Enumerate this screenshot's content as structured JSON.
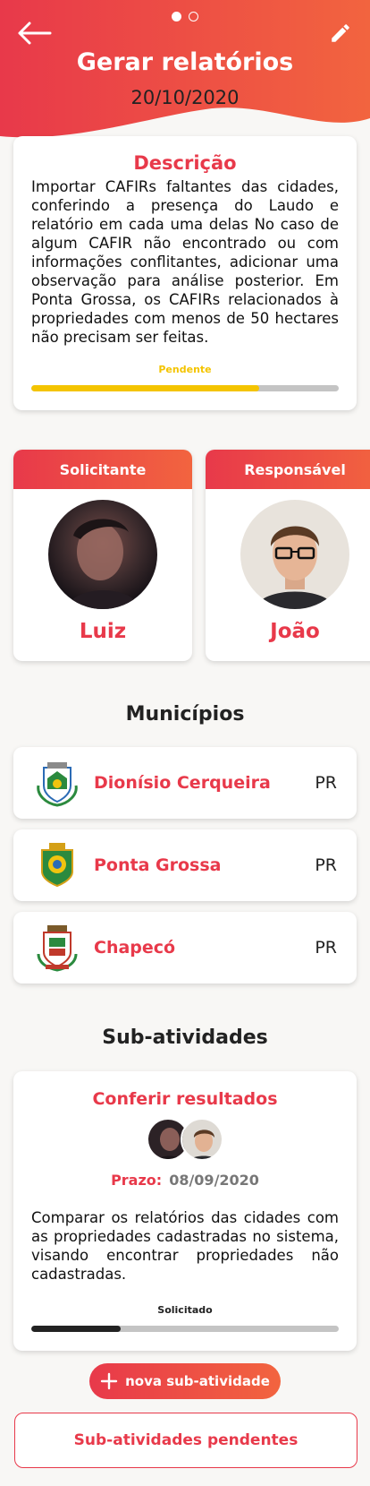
{
  "header": {
    "title": "Gerar relatórios",
    "date": "20/10/2020",
    "back_icon": "arrow-left-icon",
    "edit_icon": "pencil-icon",
    "page_dots": 2,
    "active_dot": 0
  },
  "description": {
    "title": "Descrição",
    "text": "Importar CAFIRs faltantes das cidades, conferindo a presença do Laudo e relatório em cada uma delas No caso de algum CAFIR não encontrado ou com informações conflitantes, adicionar uma observação para análise posterior. Em Ponta Grossa, os CAFIRs relacionados à propriedades com menos de 50 hectares não precisam ser feitas.",
    "status": "Pendente",
    "status_color": "#f4c400",
    "progress": 0.74
  },
  "people": {
    "requester": {
      "label": "Solicitante",
      "name": "Luiz"
    },
    "responsible": {
      "label": "Responsável",
      "name": "João"
    }
  },
  "municipalities": {
    "title": "Municípios",
    "items": [
      {
        "name": "Dionísio Cerqueira",
        "state": "PR"
      },
      {
        "name": "Ponta Grossa",
        "state": "PR"
      },
      {
        "name": "Chapecó",
        "state": "PR"
      }
    ]
  },
  "subactivities": {
    "title": "Sub-atividades",
    "items": [
      {
        "title": "Conferir resultados",
        "deadline_label": "Prazo:",
        "deadline": "08/09/2020",
        "text": "Comparar os relatórios das cidades com as propriedades cadastradas no sistema, visando encontrar propriedades não cadastradas.",
        "status": "Solicitado",
        "status_color": "#222222",
        "progress": 0.29
      }
    ],
    "new_button": "nova sub-atividade",
    "pending_button": "Sub-atividades pendentes"
  },
  "colors": {
    "accent": "#e8394a",
    "accent_alt": "#f2643f"
  }
}
